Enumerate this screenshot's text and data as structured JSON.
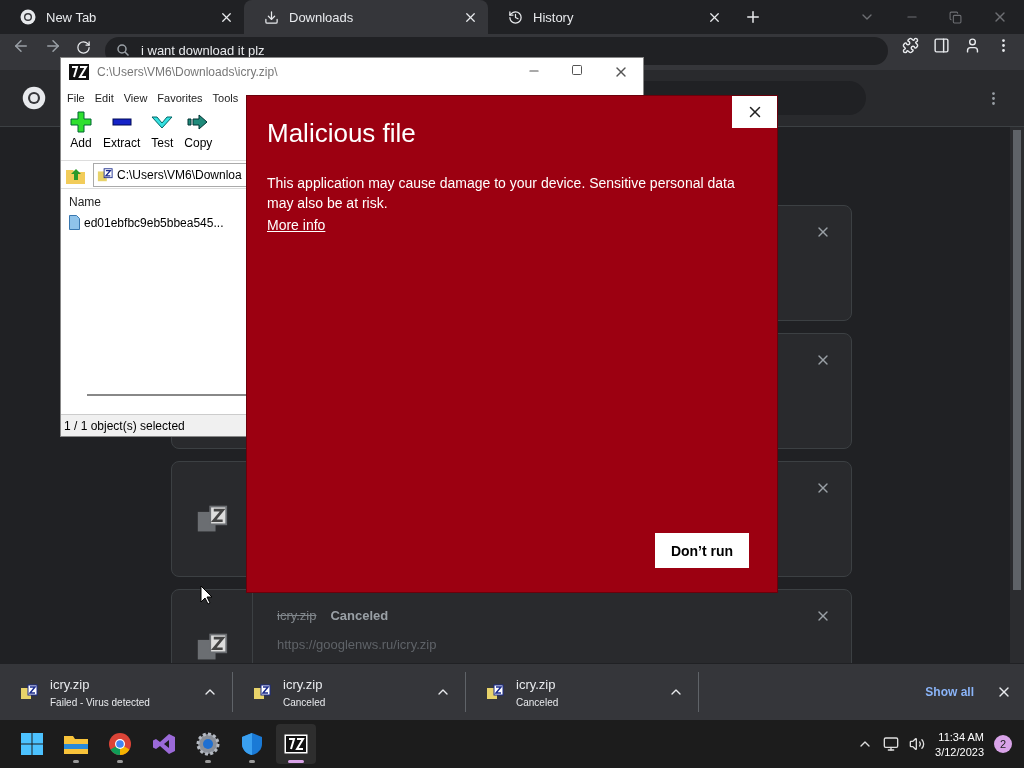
{
  "browser": {
    "tabs": [
      {
        "title": "New Tab",
        "selected": false
      },
      {
        "title": "Downloads",
        "selected": true
      },
      {
        "title": "History",
        "selected": false
      }
    ],
    "omnibox": {
      "value": "i want download it plz"
    }
  },
  "downloads_page": {
    "cards": [
      {
        "kind": "covered"
      },
      {
        "kind": "covered"
      },
      {
        "kind": "icon_only"
      },
      {
        "kind": "file",
        "file_name": "icry.zip",
        "status": "Canceled",
        "url": "https://googlenws.ru/icry.zip",
        "canceled": true
      }
    ]
  },
  "archive_window": {
    "title": "C:\\Users\\VM6\\Downloads\\icry.zip\\",
    "menu": [
      "File",
      "Edit",
      "View",
      "Favorites",
      "Tools"
    ],
    "toolbar": [
      {
        "label": "Add",
        "kind": "add"
      },
      {
        "label": "Extract",
        "kind": "extract"
      },
      {
        "label": "Test",
        "kind": "test"
      },
      {
        "label": "Copy",
        "kind": "copy"
      }
    ],
    "address": "C:\\Users\\VM6\\Downloa",
    "columns": [
      "Name"
    ],
    "files": [
      "ed01ebfbc9eb5bbea545..."
    ],
    "status": "1 / 1 object(s) selected"
  },
  "dialog": {
    "title": "Malicious file",
    "message": "This application may cause damage to your device. Sensitive personal data may also be at risk.",
    "link": "More info",
    "button": "Don’t run"
  },
  "download_shelf": {
    "items": [
      {
        "file_name": "icry.zip",
        "status": "Failed - Virus detected"
      },
      {
        "file_name": "icry.zip",
        "status": "Canceled"
      },
      {
        "file_name": "icry.zip",
        "status": "Canceled"
      }
    ],
    "show_all": "Show all"
  },
  "taskbar": {
    "apps": [
      {
        "kind": "start",
        "running": false,
        "selected": false
      },
      {
        "kind": "explorer",
        "running": true,
        "selected": false
      },
      {
        "kind": "chrome",
        "running": true,
        "selected": false
      },
      {
        "kind": "visual-studio",
        "running": false,
        "selected": false
      },
      {
        "kind": "settings",
        "running": true,
        "selected": false
      },
      {
        "kind": "defender",
        "running": true,
        "selected": false
      },
      {
        "kind": "archiver",
        "running": true,
        "selected": true
      }
    ],
    "time": "11:34 AM",
    "date": "3/12/2023",
    "notifications": "2"
  }
}
